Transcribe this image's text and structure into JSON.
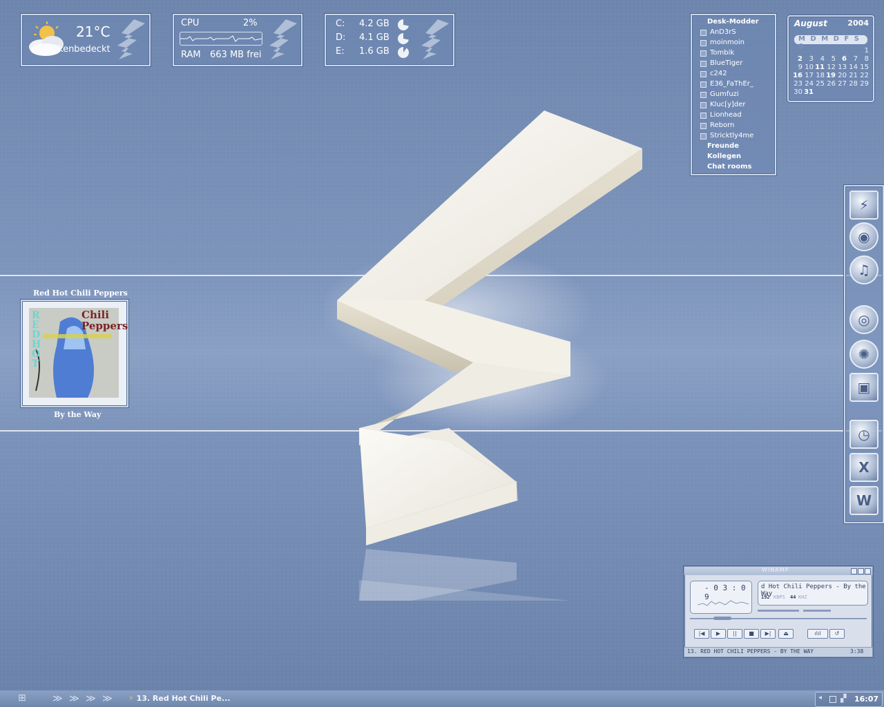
{
  "weather": {
    "temperature": "21°C",
    "condition": "kenbedeckt",
    "icon": "partly-cloudy-icon"
  },
  "cpu": {
    "cpu_label": "CPU",
    "cpu_value": "2%",
    "ram_label": "RAM",
    "ram_value": "663 MB frei"
  },
  "disks": [
    {
      "drive": "C:",
      "free": "4.2 GB"
    },
    {
      "drive": "D:",
      "free": "4.1 GB"
    },
    {
      "drive": "E:",
      "free": "1.6 GB"
    }
  ],
  "buddy_list": {
    "group": "Desk-Modder",
    "members": [
      "AnD3rS",
      "moinmoin",
      "Tombik",
      "BlueTiger",
      "c242",
      "E36_FaThEr_",
      "Gumfuzi",
      "Kluc[y]der",
      "Lionhead",
      "Reborn",
      "Stricktly4me"
    ],
    "groups": [
      "Freunde",
      "Kollegen",
      "Chat rooms"
    ]
  },
  "calendar": {
    "month": "August",
    "year": "2004",
    "weekdays": "M D M D F S S",
    "rows": [
      [
        "",
        "",
        "",
        "",
        "",
        "",
        "1"
      ],
      [
        "2",
        "3",
        "4",
        "5",
        "6",
        "7",
        "8"
      ],
      [
        "9",
        "10",
        "11",
        "12",
        "13",
        "14",
        "15"
      ],
      [
        "16",
        "17",
        "18",
        "19",
        "20",
        "21",
        "22"
      ],
      [
        "23",
        "24",
        "25",
        "26",
        "27",
        "28",
        "29"
      ],
      [
        "30",
        "31",
        "",
        "",
        "",
        "",
        ""
      ]
    ]
  },
  "album": {
    "artist": "Red Hot Chili Peppers",
    "title": "By the Way",
    "cover_text_left": "RED HOT",
    "cover_text_right": "Chili Peppers"
  },
  "dock": {
    "items": [
      "winamp-bolt-icon",
      "eye-icon",
      "music-cd-icon",
      "globe-icon",
      "browser-icon",
      "monitor-icon",
      "clock-icon",
      "excel-icon",
      "word-icon"
    ]
  },
  "winamp": {
    "window_title": "WINAMP",
    "time": "- 0 3 : 0 9",
    "track": "d Hot Chili Peppers - By the Way",
    "kbps": "192",
    "kbps_label": "KBPS",
    "khz": "44",
    "khz_label": "KHZ",
    "playlist_entry": "13. RED HOT CHILI PEPPERS - BY THE WAY",
    "playlist_time": "3:38",
    "buttons": [
      "prev",
      "play",
      "pause",
      "stop",
      "next",
      "eject"
    ]
  },
  "taskbar": {
    "task_label": "13. Red Hot Chili Pe...",
    "clock": "16:07"
  }
}
